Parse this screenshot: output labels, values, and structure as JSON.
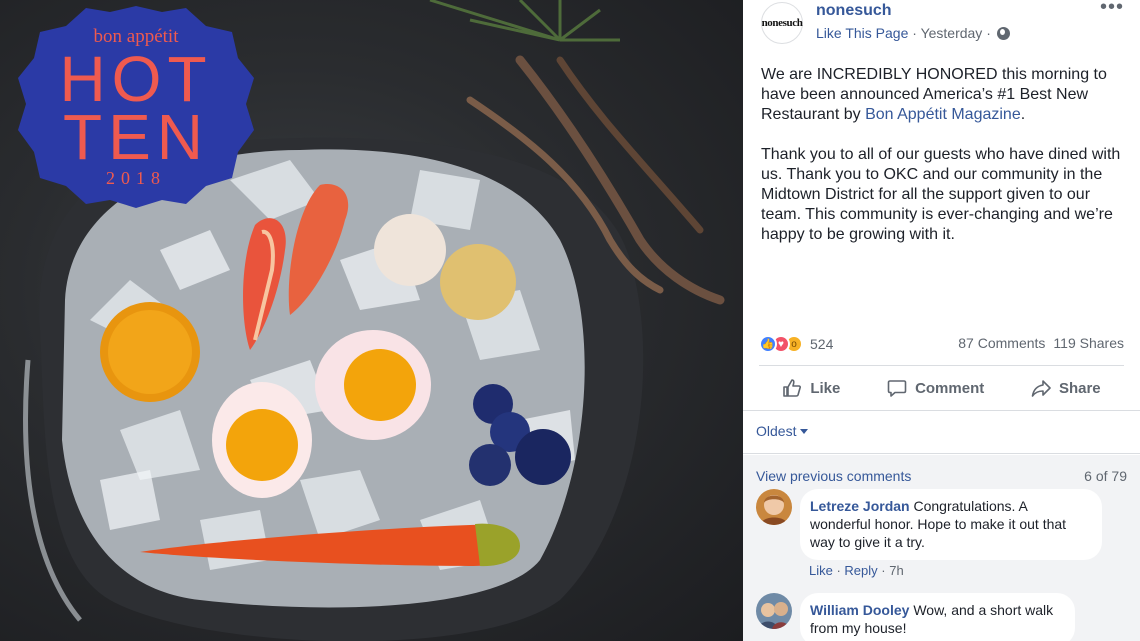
{
  "photo": {
    "badge": {
      "brand": "bon appétit",
      "line1": "HOT",
      "line2": "TEN",
      "year": "2018",
      "color": "#2b3aa6",
      "text_color": "#ef5a4f"
    }
  },
  "post": {
    "page_name": "nonesuch",
    "avatar_text": "nonesuch",
    "like_page": "Like This Page",
    "separator": " · ",
    "time": "Yesterday",
    "separator2": " · ",
    "more": "•••",
    "paragraph1_a": "We are INCREDIBLY HONORED this morning to have been announced America’s #1 Best New Restaurant by ",
    "paragraph1_link": "Bon Appétit Magazine",
    "paragraph1_b": ".",
    "paragraph2": "Thank you to all of our guests who have dined with us. Thank you to OKC and our community in the Midtown District for all the support given to our team. This community is ever-changing and we’re happy to be growing with it."
  },
  "stats": {
    "reaction_count": "524",
    "comments": "87 Comments",
    "shares": "119 Shares"
  },
  "actions": {
    "like": "Like",
    "comment": "Comment",
    "share": "Share"
  },
  "comments_section": {
    "sort": "Oldest",
    "view_previous": "View previous comments",
    "count": "6 of 79",
    "items": [
      {
        "name": "Letreze Jordan",
        "text": "Congratulations. A wonderful honor. Hope to make it out that way to give it a try.",
        "like": "Like",
        "reply": "Reply",
        "sep": " · ",
        "time": "7h"
      },
      {
        "name": "William Dooley",
        "text": "Wow, and a short walk from my house!"
      }
    ]
  },
  "colors": {
    "link": "#365899",
    "like_blue": "#4080ff",
    "love_red": "#f25268",
    "wow_yellow": "#f7b125"
  }
}
